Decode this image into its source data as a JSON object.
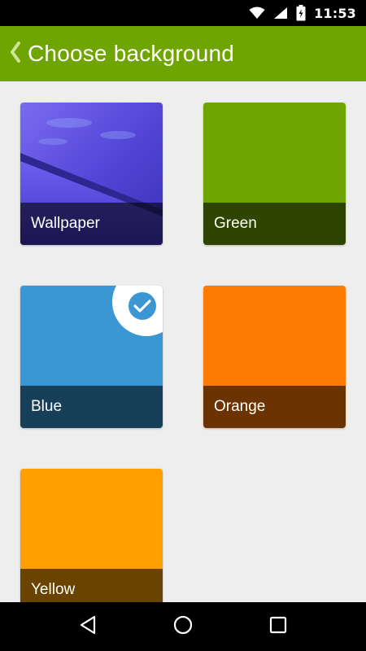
{
  "status_bar": {
    "time": "11:53",
    "icons": [
      "wifi-icon",
      "signal-icon",
      "battery-charging-icon"
    ]
  },
  "app_bar": {
    "title": "Choose background",
    "back_icon": "chevron-left-icon",
    "color": "#6fa500"
  },
  "tiles": [
    {
      "label": "Wallpaper",
      "color": "#5b4fe0",
      "selected": false
    },
    {
      "label": "Green",
      "color": "#6fa500",
      "selected": false
    },
    {
      "label": "Blue",
      "color": "#3a97d3",
      "selected": true
    },
    {
      "label": "Orange",
      "color": "#ff7a00",
      "selected": false
    },
    {
      "label": "Yellow",
      "color": "#ff9f00",
      "selected": false
    }
  ],
  "nav_bar": {
    "icons": [
      "back-triangle-icon",
      "home-circle-icon",
      "recents-square-icon"
    ]
  }
}
